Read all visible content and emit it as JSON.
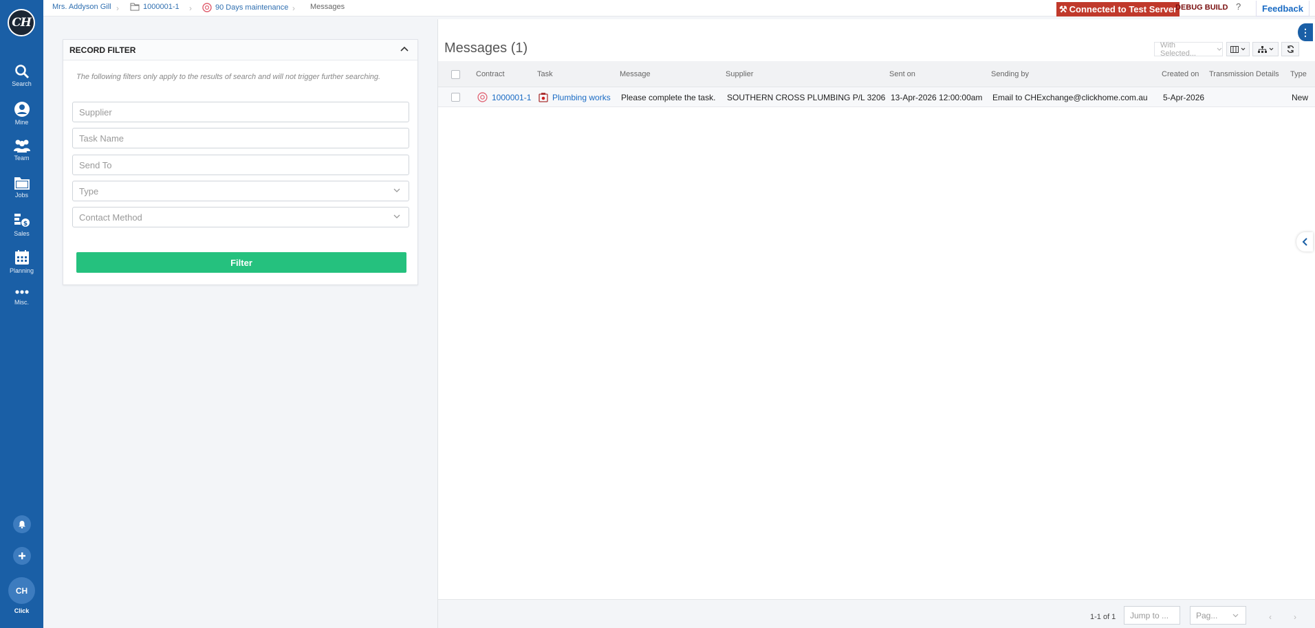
{
  "app": {
    "logo_text": "CH",
    "accent": "#1a5fa6",
    "filter_color": "#25c17e"
  },
  "sidebar": {
    "items": [
      {
        "label": "Search",
        "icon": "search-icon"
      },
      {
        "label": "Mine",
        "icon": "user-icon"
      },
      {
        "label": "Team",
        "icon": "team-icon"
      },
      {
        "label": "Jobs",
        "icon": "folder-icon"
      },
      {
        "label": "Sales",
        "icon": "sales-icon"
      },
      {
        "label": "Planning",
        "icon": "calendar-icon"
      },
      {
        "label": "Misc.",
        "icon": "more-icon"
      }
    ],
    "avatar_initials": "CH",
    "avatar_label": "Click"
  },
  "breadcrumb": {
    "items": [
      "Mrs. Addyson Gill",
      "1000001-1",
      "90 Days maintenance",
      "Messages"
    ]
  },
  "topbar": {
    "connection": "Connected to Test Server",
    "debug": "DEBUG BUILD",
    "help": "?",
    "feedback": "Feedback"
  },
  "filter": {
    "title": "RECORD FILTER",
    "note": "The following filters only apply to the results of search and will not trigger further searching.",
    "fields": {
      "supplier": "Supplier",
      "task_name": "Task Name",
      "send_to": "Send To",
      "type": "Type",
      "contact_method": "Contact Method"
    },
    "button": "Filter"
  },
  "messages": {
    "title": "Messages (1)",
    "with_selected": "With Selected...",
    "columns": [
      "Contract",
      "Task",
      "Message",
      "Supplier",
      "Sent on",
      "Sending by",
      "Created on",
      "Transmission Details",
      "Type"
    ],
    "rows": [
      {
        "contract": "1000001-1",
        "task": "Plumbing works",
        "message": "Please complete the task.",
        "supplier": "SOUTHERN CROSS PLUMBING P/L 3206",
        "sent_on": "13-Apr-2026 12:00:00am",
        "sending_by": "Email to CHExchange@clickhome.com.au",
        "created_on": "5-Apr-2026",
        "transmission_details": "",
        "type": "New"
      }
    ],
    "pagination": {
      "info": "1-1 of 1",
      "jump_placeholder": "Jump to ...",
      "page_placeholder": "Pag..."
    }
  }
}
